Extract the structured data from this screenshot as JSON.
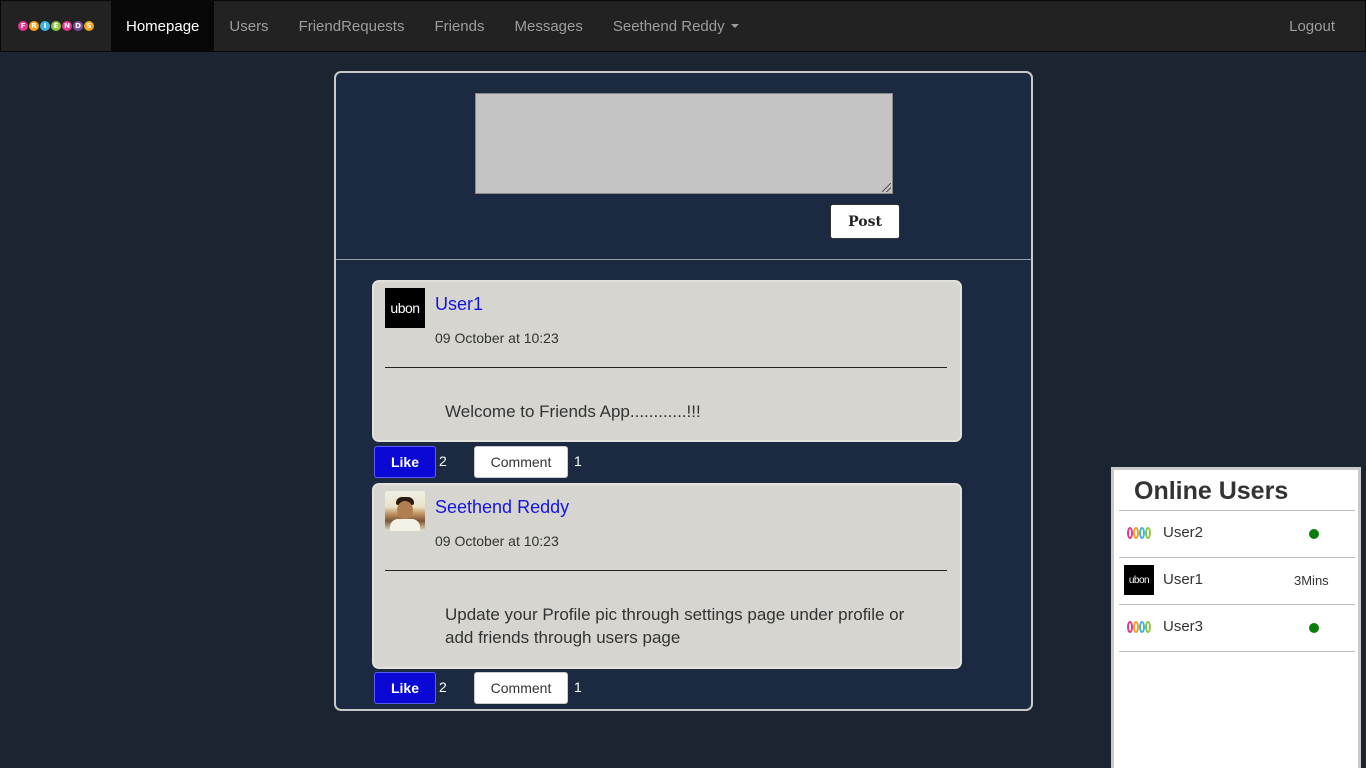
{
  "nav": {
    "brand_letters": [
      "F",
      "R",
      "I",
      "E",
      "N",
      "D",
      "S"
    ],
    "brand_colors": [
      "#e6358b",
      "#f7a21b",
      "#3cb4e5",
      "#8cc63f",
      "#e6358b",
      "#7b4fa0",
      "#f7a21b"
    ],
    "items": [
      {
        "label": "Homepage",
        "active": true
      },
      {
        "label": "Users"
      },
      {
        "label": "FriendRequests"
      },
      {
        "label": "Friends"
      },
      {
        "label": "Messages"
      },
      {
        "label": "Seethend Reddy"
      }
    ],
    "logout_label": "Logout"
  },
  "composer": {
    "value": "",
    "post_label": "Post"
  },
  "posts": [
    {
      "author": "User1",
      "avatar_text": "ubon",
      "time": "09 October at 10:23",
      "body": "Welcome to Friends App............!!!",
      "like_label": "Like",
      "like_count": "2",
      "comment_label": "Comment",
      "comment_count": "1"
    },
    {
      "author": "Seethend Reddy",
      "time": "09 October at 10:23",
      "body": "Update your Profile pic through settings page under profile or add friends through users page",
      "like_label": "Like",
      "like_count": "2",
      "comment_label": "Comment",
      "comment_count": "1"
    }
  ],
  "online_users": {
    "title": "Online Users",
    "users": [
      {
        "name": "User2",
        "status": "online"
      },
      {
        "name": "User1",
        "avatar_text": "ubon",
        "status_text": "3Mins"
      },
      {
        "name": "User3",
        "status": "online"
      }
    ]
  },
  "colors": {
    "page_bg": "#1b2431",
    "panel_bg": "#1b2a40",
    "like_blue": "#0b08d6",
    "online_green": "#0a7d0a",
    "link_blue": "#1414e0"
  }
}
